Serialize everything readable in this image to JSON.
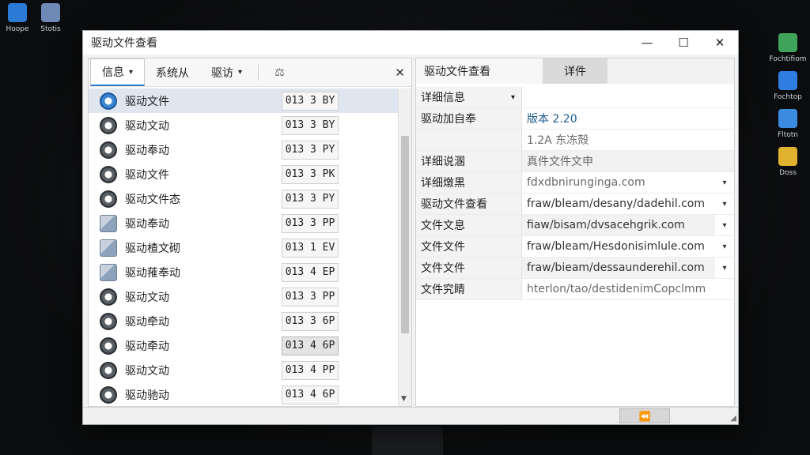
{
  "desktop": {
    "icons_left": [
      {
        "label": "Hoope",
        "icon": "home-icon",
        "color": "#2b7bd6"
      },
      {
        "label": "Stotis",
        "icon": "stats-icon",
        "color": "#6e89b5"
      }
    ],
    "icons_right": [
      {
        "label": "Fochtifiom",
        "icon": "notes-icon",
        "color": "#3fa35a"
      },
      {
        "label": "Fochtop",
        "icon": "shield-icon",
        "color": "#2f7de0"
      },
      {
        "label": "Fltotn",
        "icon": "cloud-icon",
        "color": "#3b8be0"
      },
      {
        "label": "Doss",
        "icon": "tool-icon",
        "color": "#e0b22f"
      }
    ]
  },
  "window": {
    "title": "驱动文件查看",
    "minimize": "—",
    "maximize": "☐",
    "close": "✕"
  },
  "toolbar": {
    "info_label": "信息",
    "info_arrow": "▾",
    "system_label": "系统从",
    "driver_label": "驱访",
    "driver_arrow": "▾",
    "scale_icon": "⚖",
    "close_label": "✕"
  },
  "list": [
    {
      "name": "驱动文件",
      "size": "013 3 BY",
      "icon": "gear-blue",
      "selected": true
    },
    {
      "name": "驱动文动",
      "size": "013 3 BY",
      "icon": "gear"
    },
    {
      "name": "驱动奉动",
      "size": "013 3 PY",
      "icon": "gear"
    },
    {
      "name": "驱动文件",
      "size": "013 3 PK",
      "icon": "gear"
    },
    {
      "name": "驱动文件态",
      "size": "013 3 PY",
      "icon": "gear"
    },
    {
      "name": "驱动奉动",
      "size": "013 3 PP",
      "icon": "cube"
    },
    {
      "name": "驱动楂文砌",
      "size": "013 1 EV",
      "icon": "cube"
    },
    {
      "name": "驱动蓷奉动",
      "size": "013 4 EP",
      "icon": "cube"
    },
    {
      "name": "驱动文动",
      "size": "013 3 PP",
      "icon": "gear"
    },
    {
      "name": "驱动牵动",
      "size": "013 3 6P",
      "icon": "gear"
    },
    {
      "name": "驱动牵动",
      "size": "013 4 6P",
      "icon": "gear",
      "pressed": true
    },
    {
      "name": "驱动文动",
      "size": "013 4 PP",
      "icon": "gear"
    },
    {
      "name": "驱动驰动",
      "size": "013 4 6P",
      "icon": "gear"
    }
  ],
  "right": {
    "tab1": "驱动文件查看",
    "tab2": "详件",
    "properties": [
      {
        "key": "详细信息",
        "value": "",
        "dropdown_key": true
      },
      {
        "key": "驱动加自奉",
        "value": "版本 2.20",
        "style": "accent"
      },
      {
        "key": "",
        "value": "1.2A 东冻殻",
        "style": "muted"
      },
      {
        "key": "详细说溷",
        "value": "真件文件文申",
        "style": "muted",
        "alt": true
      },
      {
        "key": "详细燉黒",
        "value": "fdxdbnirunginga.com",
        "style": "muted",
        "dropdown": true
      },
      {
        "key": "驱动文件查看",
        "value": "fraw/bleam/desany/dadehil.com",
        "dropdown": true
      },
      {
        "key": "文件文息",
        "value": "fiaw/bisam/dvsacehgrik.com",
        "dropdown": true,
        "alt": true
      },
      {
        "key": "文件文件",
        "value": "fraw/bleam/Hesdonisimlule.com",
        "dropdown": true
      },
      {
        "key": "文件文件",
        "value": "fraw/bieam/dessaunderehil.com",
        "dropdown": true,
        "alt": true
      },
      {
        "key": "文件究睛",
        "value": "hterlon/tao/destidenimCopclmm",
        "style": "muted"
      }
    ],
    "status_button": "⏪"
  }
}
